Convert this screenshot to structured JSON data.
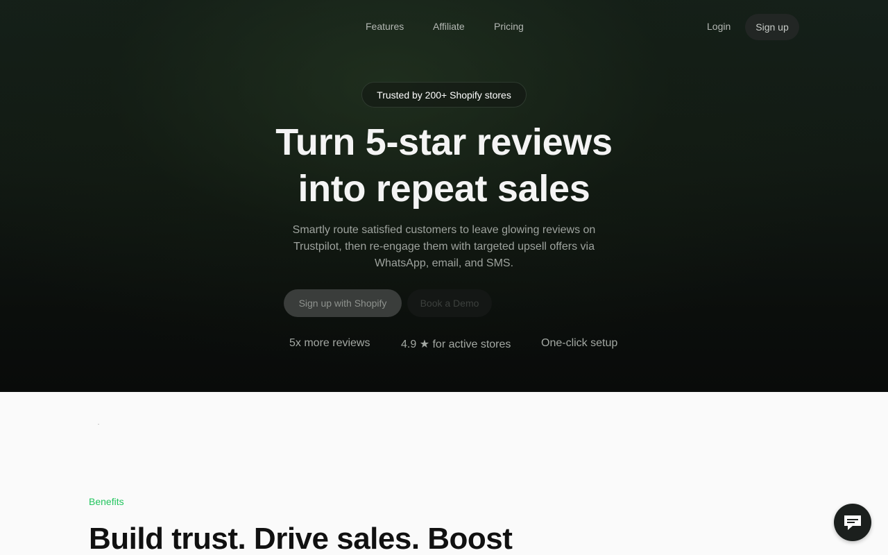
{
  "nav": {
    "links": [
      "Features",
      "Affiliate",
      "Pricing"
    ],
    "login_label": "Login",
    "signup_label": "Sign up"
  },
  "hero": {
    "badge": "Trusted by 200+ Shopify stores",
    "headline_line1": "Turn 5-star reviews",
    "headline_line2": "into repeat sales",
    "subtext": "Smartly route satisfied customers to leave glowing reviews on Trustpilot, then re-engage them with targeted upsell offers via WhatsApp, email, and SMS.",
    "cta_primary": "Sign up with Shopify",
    "cta_secondary": "Book a Demo",
    "stats": [
      "5x more reviews",
      "4.9 ★ for active stores",
      "One-click setup"
    ]
  },
  "benefits": {
    "label": "Benefits",
    "title": "Build trust. Drive sales. Boost"
  },
  "chat": {
    "icon": "chat-bubble-icon"
  },
  "colors": {
    "accent_green": "#22c55e",
    "hero_bg": "#0b0e0c"
  }
}
